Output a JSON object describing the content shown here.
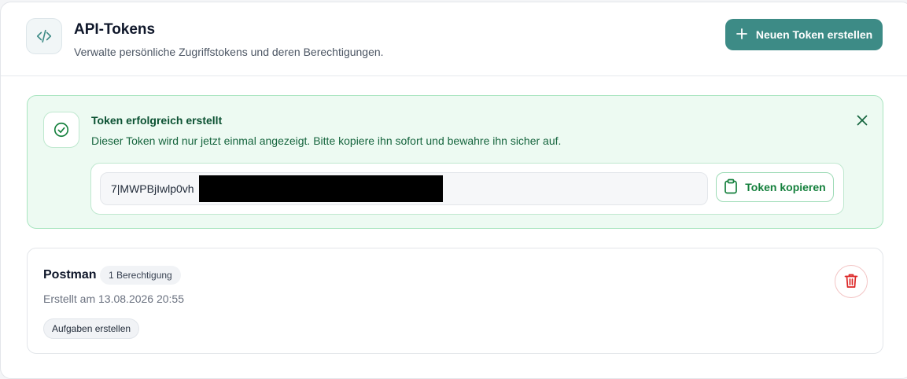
{
  "header": {
    "title": "API-Tokens",
    "subtitle": "Verwalte persönliche Zugriffstokens und deren Berechtigungen.",
    "icon": "code-icon",
    "new_token_label": "Neuen Token erstellen",
    "new_token_icon": "plus-icon",
    "accent_color": "#3d8b86"
  },
  "alert": {
    "title": "Token erfolgreich erstellt",
    "message": "Dieser Token wird nur jetzt einmal angezeigt. Bitte kopiere ihn sofort und bewahre ihn sicher auf.",
    "icon": "check-circle-icon",
    "close_icon": "close-icon",
    "token_value": "7|MWPBjIwlp0vh",
    "copy_label": "Token kopieren",
    "copy_icon": "clipboard-icon",
    "success_color": "#15803d"
  },
  "tokens": [
    {
      "name": "Postman",
      "permission_count": "1 Berechtigung",
      "created": "Erstellt am 13.08.2026 20:55",
      "scopes": [
        "Aufgaben erstellen"
      ],
      "delete_icon": "trash-icon",
      "danger_color": "#dc2626"
    }
  ]
}
